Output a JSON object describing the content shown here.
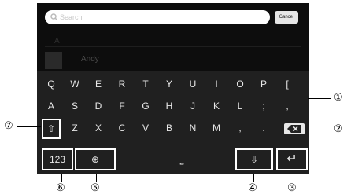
{
  "search": {
    "placeholder": "Search",
    "cancel_label": "Cancel"
  },
  "contacts": {
    "section_letter": "A",
    "items": [
      {
        "name": "Andy"
      }
    ]
  },
  "keyboard": {
    "row1": [
      "Q",
      "W",
      "E",
      "R",
      "T",
      "Y",
      "U",
      "I",
      "O",
      "P",
      "["
    ],
    "row2": [
      "A",
      "S",
      "D",
      "F",
      "G",
      "H",
      "J",
      "K",
      "L",
      ";",
      ","
    ],
    "row3": [
      "Z",
      "X",
      "C",
      "V",
      "B",
      "N",
      "M",
      ",",
      "."
    ],
    "numbers_label": "123",
    "space_glyph": "⎵",
    "hide_keyboard_glyph": "⇩",
    "enter_glyph": "↵",
    "shift_glyph": "⇧",
    "globe_glyph": "⊕"
  },
  "callouts": [
    "①",
    "②",
    "③",
    "④",
    "⑤",
    "⑥",
    "⑦"
  ]
}
